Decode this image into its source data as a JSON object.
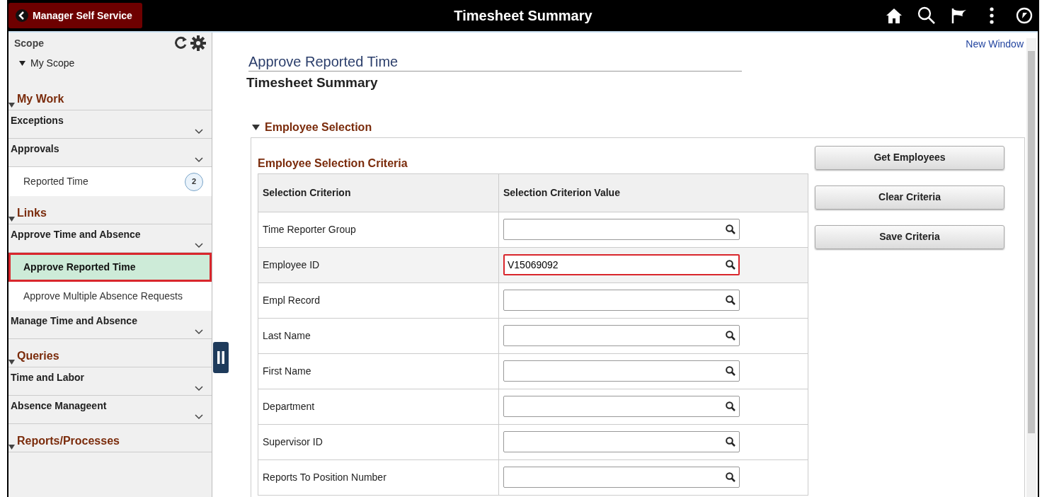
{
  "header": {
    "back_button": "Manager Self Service",
    "title": "Timesheet Summary"
  },
  "sidebar": {
    "scope": {
      "label": "Scope",
      "tree_item": "My Scope"
    },
    "sections": [
      {
        "title": "My Work",
        "items": [
          {
            "kind": "group",
            "label": "Exceptions"
          },
          {
            "kind": "group",
            "label": "Approvals"
          },
          {
            "kind": "link",
            "label": "Reported Time",
            "badge": "2",
            "selected": false
          }
        ]
      },
      {
        "title": "Links",
        "items": [
          {
            "kind": "group",
            "label": "Approve Time and Absence"
          },
          {
            "kind": "link",
            "label": "Approve Reported Time",
            "selected": true
          },
          {
            "kind": "link",
            "label": "Approve Multiple Absence Requests",
            "selected": false
          },
          {
            "kind": "group",
            "label": "Manage Time and Absence"
          }
        ]
      },
      {
        "title": "Queries",
        "items": [
          {
            "kind": "group",
            "label": "Time and Labor"
          },
          {
            "kind": "group",
            "label": "Absence Manageent"
          }
        ]
      },
      {
        "title": "Reports/Processes"
      }
    ]
  },
  "main": {
    "new_window": "New Window",
    "page_title": "Approve Reported Time",
    "subtitle": "Timesheet Summary",
    "section": {
      "title": "Employee Selection",
      "expanded": true,
      "grid_title": "Employee Selection Criteria",
      "columns": [
        "Selection Criterion",
        "Selection Criterion Value"
      ],
      "rows": [
        {
          "label": "Time Reporter Group",
          "highlighted": false
        },
        {
          "label": "Employee ID",
          "value": "V15069092",
          "highlighted": true
        },
        {
          "label": "Empl Record",
          "highlighted": false
        },
        {
          "label": "Last Name",
          "highlighted": false
        },
        {
          "label": "First Name",
          "highlighted": false
        },
        {
          "label": "Department",
          "highlighted": false
        },
        {
          "label": "Supervisor ID",
          "highlighted": false
        },
        {
          "label": "Reports To Position Number",
          "highlighted": false
        }
      ],
      "buttons": [
        "Get Employees",
        "Clear Criteria",
        "Save Criteria"
      ]
    }
  }
}
